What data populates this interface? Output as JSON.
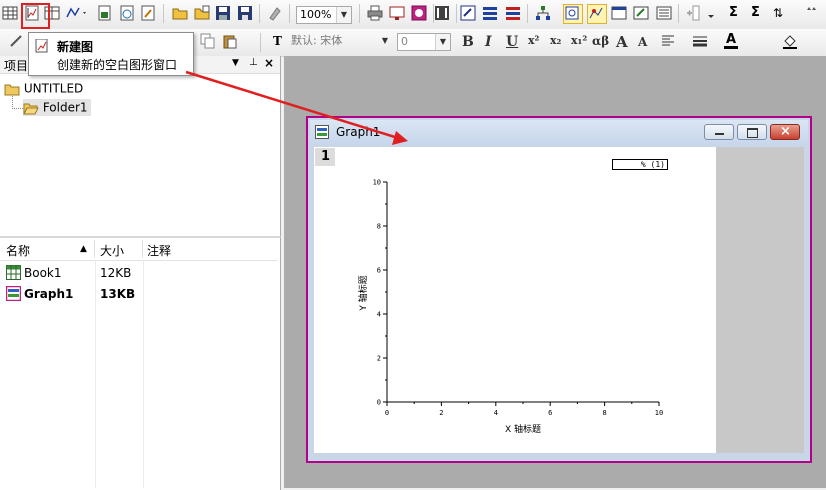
{
  "toolbar": {
    "zoom": "100%",
    "font_name": "默认: 宋体",
    "font_size": "0",
    "format_buttons": [
      "B",
      "I",
      "U",
      "x²",
      "x₂",
      "x₁²",
      "αβ",
      "A",
      "A"
    ]
  },
  "tooltip": {
    "title": "新建图",
    "description": "创建新的空白图形窗口"
  },
  "project_explorer": {
    "title": "项目",
    "tree": {
      "root": "UNTITLED",
      "folder": "Folder1"
    }
  },
  "file_list": {
    "columns": [
      "名称",
      "大小",
      "注释"
    ],
    "rows": [
      {
        "name": "Book1",
        "size": "12KB",
        "comment": "",
        "bold": false,
        "icon": "workbook-icon"
      },
      {
        "name": "Graph1",
        "size": "13KB",
        "comment": "",
        "bold": true,
        "icon": "graph-icon"
      }
    ]
  },
  "graph_window": {
    "title": "Graph1",
    "layer_number": "1",
    "legend": "% (1)",
    "x_axis_title": "X 轴标题",
    "y_axis_title": "Y 轴标题",
    "x_ticks": [
      "0",
      "2",
      "4",
      "6",
      "8",
      "10"
    ],
    "y_ticks": [
      "0",
      "2",
      "4",
      "6",
      "8",
      "10"
    ]
  },
  "chart_data": {
    "type": "scatter",
    "series": [],
    "xlabel": "X 轴标题",
    "ylabel": "Y 轴标题",
    "xlim": [
      0,
      10
    ],
    "ylim": [
      0,
      10
    ],
    "grid": false,
    "legend": "top-right"
  },
  "colors": {
    "highlight": "#e02020",
    "graph_border": "#b0008c",
    "window_title_bg": "#c8d7ec"
  }
}
